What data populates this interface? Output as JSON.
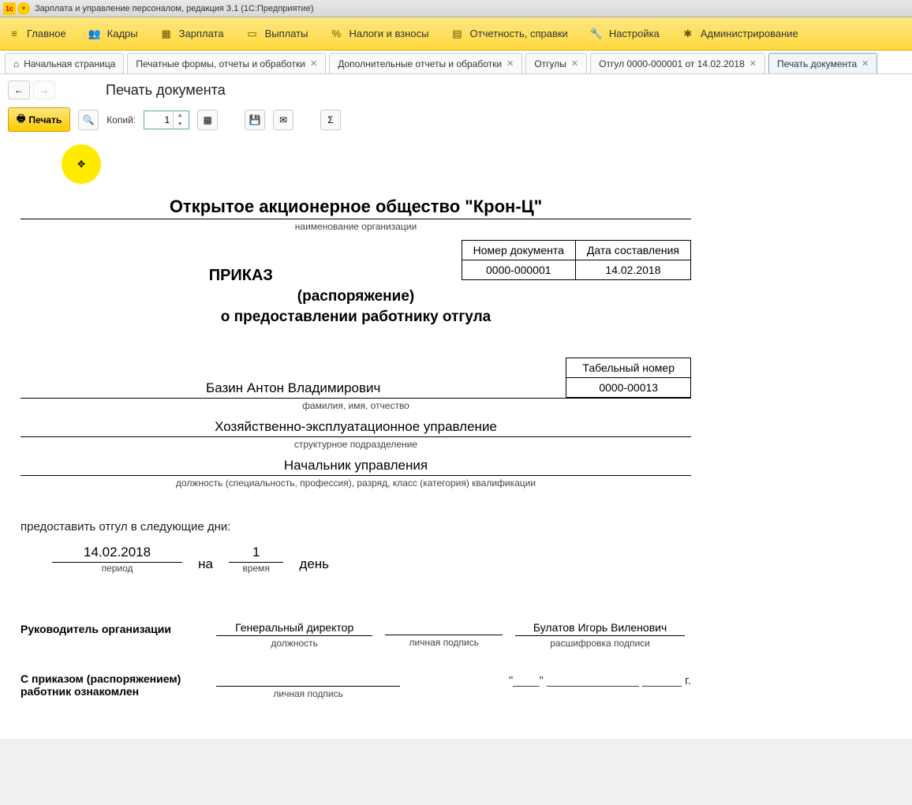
{
  "titlebar": {
    "text": "Зарплата и управление персоналом, редакция 3.1  (1С:Предприятие)"
  },
  "menu": {
    "items": [
      {
        "label": "Главное",
        "icon": "≡"
      },
      {
        "label": "Кадры",
        "icon": "👥"
      },
      {
        "label": "Зарплата",
        "icon": "▦"
      },
      {
        "label": "Выплаты",
        "icon": "▭"
      },
      {
        "label": "Налоги и взносы",
        "icon": "%"
      },
      {
        "label": "Отчетность, справки",
        "icon": "▤"
      },
      {
        "label": "Настройка",
        "icon": "🔧"
      },
      {
        "label": "Администрирование",
        "icon": "✱"
      }
    ]
  },
  "tabs": [
    {
      "label": "Начальная страница",
      "home": true,
      "closable": false
    },
    {
      "label": "Печатные формы, отчеты и обработки",
      "closable": true
    },
    {
      "label": "Дополнительные отчеты и обработки",
      "closable": true
    },
    {
      "label": "Отгулы",
      "closable": true
    },
    {
      "label": "Отгул 0000-000001 от 14.02.2018",
      "closable": true
    },
    {
      "label": "Печать документа",
      "closable": true,
      "active": true
    }
  ],
  "nav": {
    "title": "Печать документа"
  },
  "toolbar": {
    "print_label": "Печать",
    "copies_label": "Копий:",
    "copies_value": "1"
  },
  "doc": {
    "org_name": "Открытое акционерное общество \"Крон-Ц\"",
    "org_caption": "наименование организации",
    "doc_num_header": "Номер документа",
    "doc_date_header": "Дата составления",
    "doc_num": "0000-000001",
    "doc_date": "14.02.2018",
    "order_title": "ПРИКАЗ",
    "order_sub1": "(распоряжение)",
    "order_sub2": "о предоставлении работнику отгула",
    "tabnum_header": "Табельный номер",
    "tabnum": "0000-00013",
    "fio": "Базин Антон Владимирович",
    "fio_caption": "фамилия, имя, отчество",
    "dept": "Хозяйственно-эксплуатационное управление",
    "dept_caption": "структурное подразделение",
    "position": "Начальник управления",
    "position_caption": "должность (специальность, профессия), разряд, класс (категория) квалификации",
    "provide_text": "предоставить отгул в следующие дни:",
    "period": "14.02.2018",
    "period_caption": "период",
    "na": "на",
    "days": "1",
    "days_caption": "время",
    "days_word": "день",
    "head_label": "Руководитель организации",
    "head_position": "Генеральный директор",
    "head_position_caption": "должность",
    "head_sign_caption": "личная подпись",
    "head_name": "Булатов Игорь Виленович",
    "head_name_caption": "расшифровка подписи",
    "ack_label1": "С приказом (распоряжением)",
    "ack_label2": "работник ознакомлен",
    "ack_sign_caption": "личная подпись",
    "ack_date": "\"____\" ______________ ______ г."
  }
}
